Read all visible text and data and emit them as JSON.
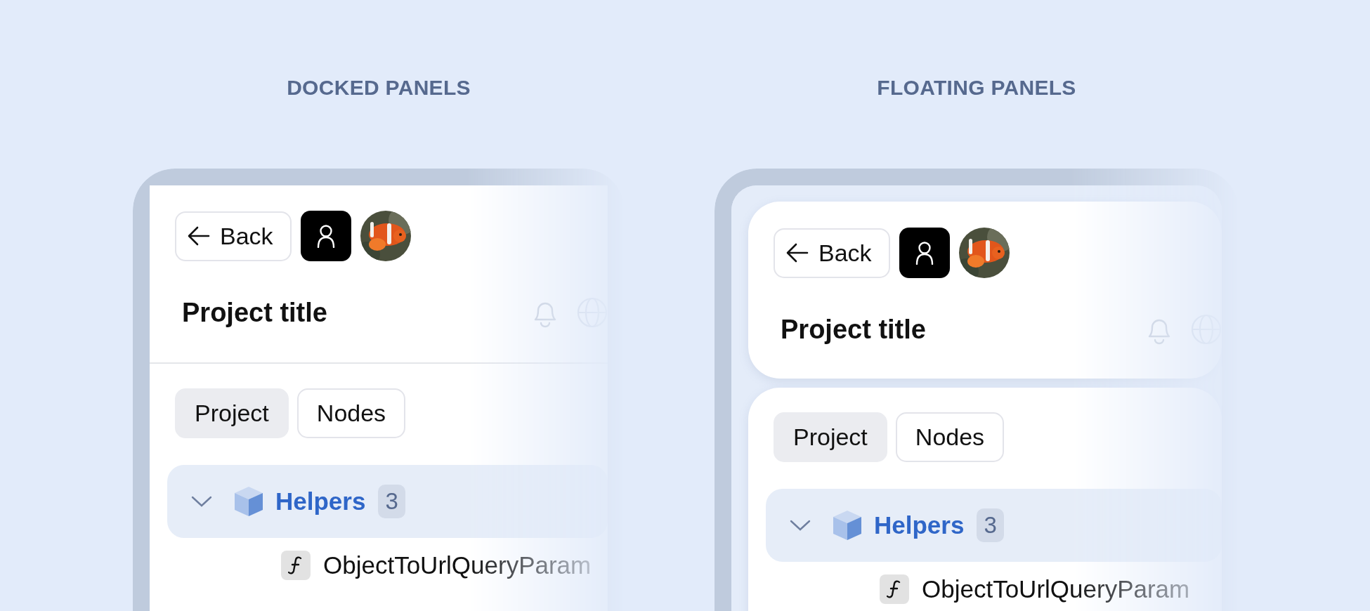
{
  "sections": [
    {
      "heading": "DOCKED PANELS",
      "kind": "docked",
      "back": "Back",
      "title": "Project title",
      "tabs": [
        {
          "label": "Project",
          "selected": true
        },
        {
          "label": "Nodes",
          "selected": false
        }
      ],
      "tree": [
        {
          "label": "Helpers",
          "count": "3",
          "expanded": true,
          "children": [
            {
              "label": "ObjectToUrlQueryParam"
            }
          ]
        }
      ]
    },
    {
      "heading": "FLOATING PANELS",
      "kind": "floating",
      "back": "Back",
      "title": "Project title",
      "tabs": [
        {
          "label": "Project",
          "selected": true
        },
        {
          "label": "Nodes",
          "selected": false
        }
      ],
      "tree": [
        {
          "label": "Helpers",
          "count": "3",
          "expanded": true,
          "children": [
            {
              "label": "ObjectToUrlQueryParam"
            }
          ]
        }
      ]
    }
  ]
}
